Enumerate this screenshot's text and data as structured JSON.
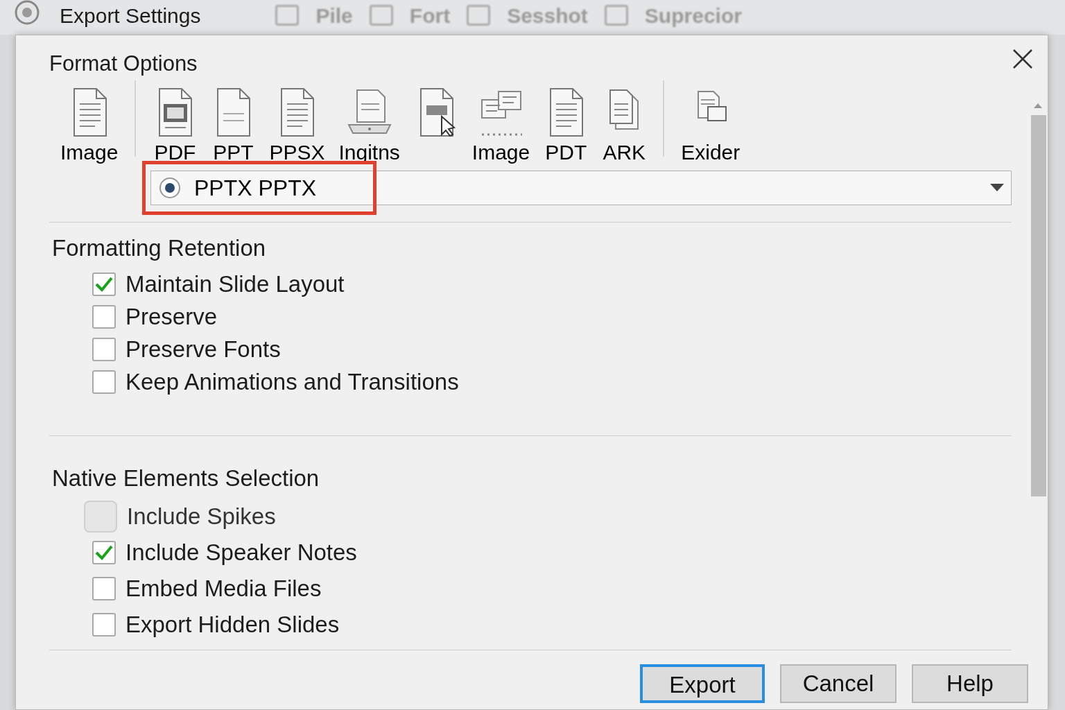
{
  "app": {
    "title": "Export Settings",
    "toolbar": [
      "Pile",
      "Fort",
      "Sesshot",
      "Suprecior"
    ]
  },
  "dialog": {
    "title": "Format Options",
    "formats": [
      {
        "label": "Image",
        "separator_after": true
      },
      {
        "label": "PDF",
        "separator_after": false
      },
      {
        "label": "PPT",
        "separator_after": false
      },
      {
        "label": "PPSX",
        "separator_after": false
      },
      {
        "label": "Ingitns",
        "separator_after": false
      },
      {
        "separator_after": false
      },
      {
        "label": "Image",
        "separator_after": false
      },
      {
        "label": "PDT",
        "separator_after": false
      },
      {
        "label": "ARK",
        "separator_after": true
      },
      {
        "label": "Exider",
        "separator_after": false
      }
    ],
    "format_select": {
      "value": "PPTX PPTX",
      "radio_checked": true,
      "highlighted": true
    },
    "sections": [
      {
        "title": "Formatting Retention",
        "options": [
          {
            "label": "Maintain Slide Layout",
            "checked": true,
            "disabled": false
          },
          {
            "label": "Preserve",
            "checked": false,
            "disabled": false
          },
          {
            "label": "Preserve Fonts",
            "checked": false,
            "disabled": false
          },
          {
            "label": "Keep Animations and Transitions",
            "checked": false,
            "disabled": false
          }
        ]
      },
      {
        "title": "Native Elements Selection",
        "options": [
          {
            "label": "Include Spikes",
            "checked": false,
            "disabled": true
          },
          {
            "label": "Include Speaker Notes",
            "checked": true,
            "disabled": false
          },
          {
            "label": "Embed Media Files",
            "checked": false,
            "disabled": false
          },
          {
            "label": "Export Hidden Slides",
            "checked": false,
            "disabled": false
          }
        ]
      }
    ],
    "buttons": [
      {
        "label": "Export",
        "focused": true
      },
      {
        "label": "Cancel",
        "focused": false
      },
      {
        "label": "Help",
        "focused": false
      }
    ]
  }
}
